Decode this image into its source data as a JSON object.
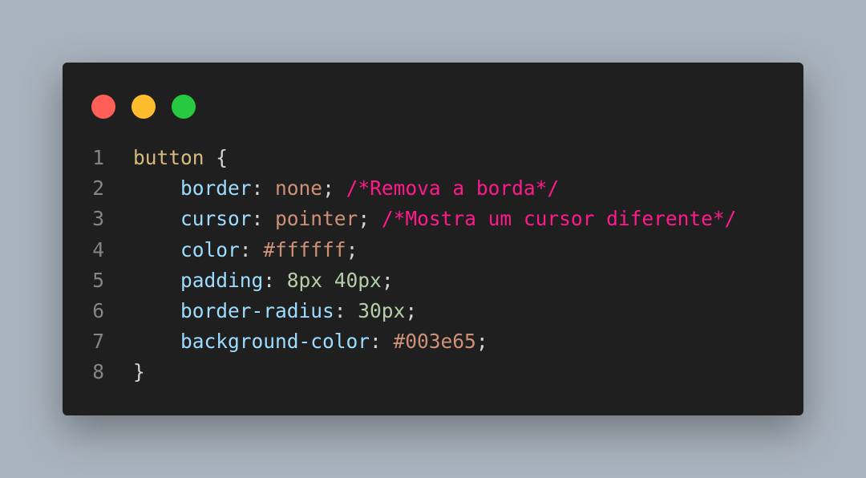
{
  "window": {
    "dots": [
      {
        "name": "close",
        "color": "#ff5f57"
      },
      {
        "name": "minimize",
        "color": "#ffbd2e"
      },
      {
        "name": "maximize",
        "color": "#28c840"
      }
    ]
  },
  "code": {
    "lines": [
      {
        "number": "1",
        "tokens": [
          {
            "text": "button",
            "type": "selector"
          },
          {
            "text": " {",
            "type": "punct"
          }
        ]
      },
      {
        "number": "2",
        "tokens": [
          {
            "text": "    ",
            "type": "punct"
          },
          {
            "text": "border",
            "type": "prop"
          },
          {
            "text": ": ",
            "type": "punct"
          },
          {
            "text": "none",
            "type": "value"
          },
          {
            "text": "; ",
            "type": "punct"
          },
          {
            "text": "/*Remova a borda*/",
            "type": "comment"
          }
        ]
      },
      {
        "number": "3",
        "tokens": [
          {
            "text": "    ",
            "type": "punct"
          },
          {
            "text": "cursor",
            "type": "prop"
          },
          {
            "text": ": ",
            "type": "punct"
          },
          {
            "text": "pointer",
            "type": "value"
          },
          {
            "text": "; ",
            "type": "punct"
          },
          {
            "text": "/*Mostra um cursor diferente*/",
            "type": "comment"
          }
        ]
      },
      {
        "number": "4",
        "tokens": [
          {
            "text": "    ",
            "type": "punct"
          },
          {
            "text": "color",
            "type": "prop"
          },
          {
            "text": ": ",
            "type": "punct"
          },
          {
            "text": "#ffffff",
            "type": "value"
          },
          {
            "text": ";",
            "type": "punct"
          }
        ]
      },
      {
        "number": "5",
        "tokens": [
          {
            "text": "    ",
            "type": "punct"
          },
          {
            "text": "padding",
            "type": "prop"
          },
          {
            "text": ": ",
            "type": "punct"
          },
          {
            "text": "8px 40px",
            "type": "number"
          },
          {
            "text": ";",
            "type": "punct"
          }
        ]
      },
      {
        "number": "6",
        "tokens": [
          {
            "text": "    ",
            "type": "punct"
          },
          {
            "text": "border-radius",
            "type": "prop"
          },
          {
            "text": ": ",
            "type": "punct"
          },
          {
            "text": "30px",
            "type": "number"
          },
          {
            "text": ";",
            "type": "punct"
          }
        ]
      },
      {
        "number": "7",
        "tokens": [
          {
            "text": "    ",
            "type": "punct"
          },
          {
            "text": "background-color",
            "type": "prop"
          },
          {
            "text": ": ",
            "type": "punct"
          },
          {
            "text": "#003e65",
            "type": "value"
          },
          {
            "text": ";",
            "type": "punct"
          }
        ]
      },
      {
        "number": "8",
        "tokens": [
          {
            "text": "}",
            "type": "punct"
          }
        ]
      }
    ]
  }
}
